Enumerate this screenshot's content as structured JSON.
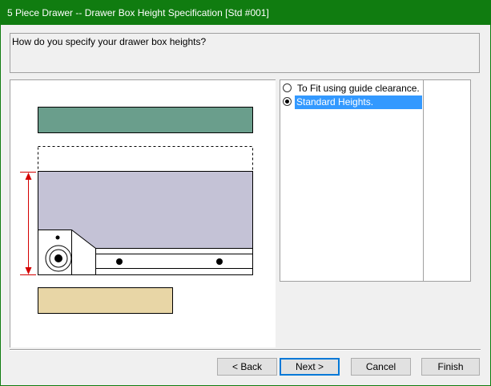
{
  "window": {
    "title": "5 Piece Drawer -- Drawer Box Height Specification [Std #001]"
  },
  "question": {
    "text": "How do you specify your drawer box heights?"
  },
  "options": [
    {
      "label": "To Fit using guide clearance.",
      "selected": false
    },
    {
      "label": "Standard Heights.",
      "selected": true
    }
  ],
  "buttons": {
    "back": "< Back",
    "next": "Next >",
    "cancel": "Cancel",
    "finish": "Finish"
  },
  "diagram": {
    "colors": {
      "drawer_front": "#6a9e8c",
      "drawer_box": "#c4c2d6",
      "bottom_panel": "#e8d6a6",
      "dimension_arrow": "#d40000"
    }
  }
}
